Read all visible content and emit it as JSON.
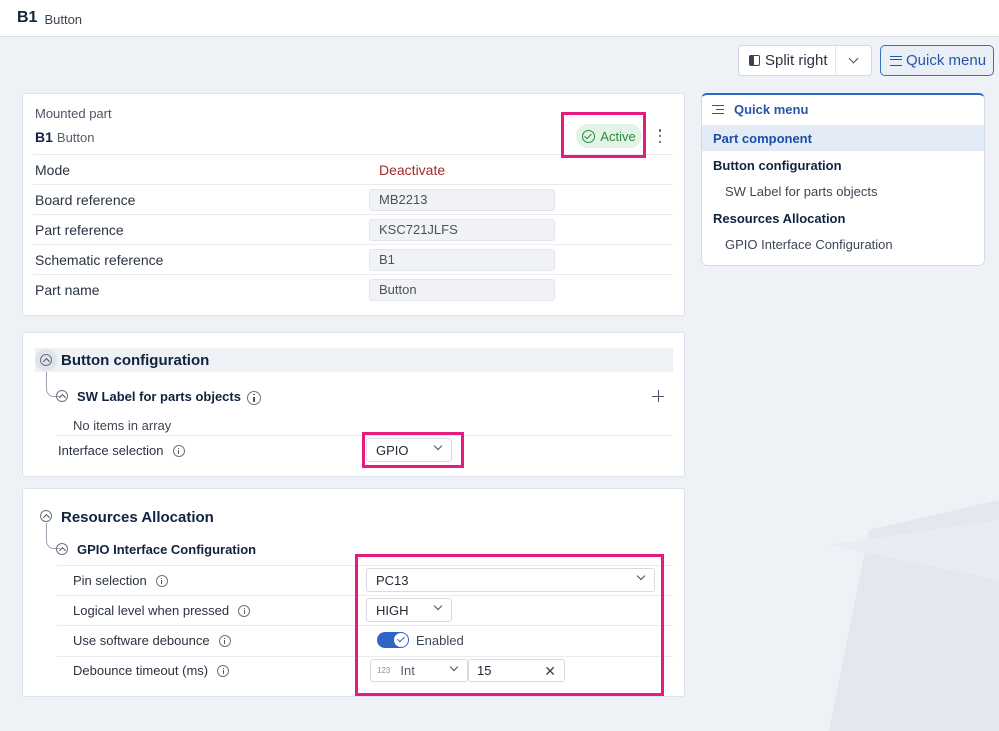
{
  "header": {
    "ref": "B1",
    "name": "Button"
  },
  "toolbar": {
    "split_label": "Split right",
    "quick_menu_label": "Quick menu"
  },
  "mounted_part": {
    "label": "Mounted part",
    "ref": "B1",
    "name": "Button",
    "status": "Active",
    "status_color": "#2b8a3e",
    "rows": [
      {
        "label": "Mode",
        "value": "Deactivate"
      },
      {
        "label": "Board reference",
        "value": "MB2213"
      },
      {
        "label": "Part reference",
        "value": "KSC721JLFS"
      },
      {
        "label": "Schematic reference",
        "value": "B1"
      },
      {
        "label": "Part name",
        "value": "Button"
      }
    ]
  },
  "button_config": {
    "title": "Button configuration",
    "sw_label_title": "SW Label for parts objects",
    "empty_text": "No items in array",
    "interface_label": "Interface selection",
    "interface_value": "GPIO"
  },
  "resources": {
    "title": "Resources Allocation",
    "gpio_title": "GPIO Interface Configuration",
    "pin_label": "Pin selection",
    "pin_value": "PC13",
    "level_label": "Logical level when pressed",
    "level_value": "HIGH",
    "debounce_label": "Use software debounce",
    "debounce_value": "Enabled",
    "timeout_label": "Debounce timeout (ms)",
    "timeout_type_icon": "123",
    "timeout_type": "Int",
    "timeout_value": "15"
  },
  "quick_menu": {
    "title": "Quick menu",
    "items": [
      {
        "label": "Part component"
      },
      {
        "label": "Button configuration"
      },
      {
        "label": "SW Label for parts objects"
      },
      {
        "label": "Resources Allocation"
      },
      {
        "label": "GPIO Interface Configuration"
      }
    ]
  },
  "colors": {
    "accent": "#2f66c6",
    "highlight": "#e8197f",
    "danger": "#a5282b"
  }
}
